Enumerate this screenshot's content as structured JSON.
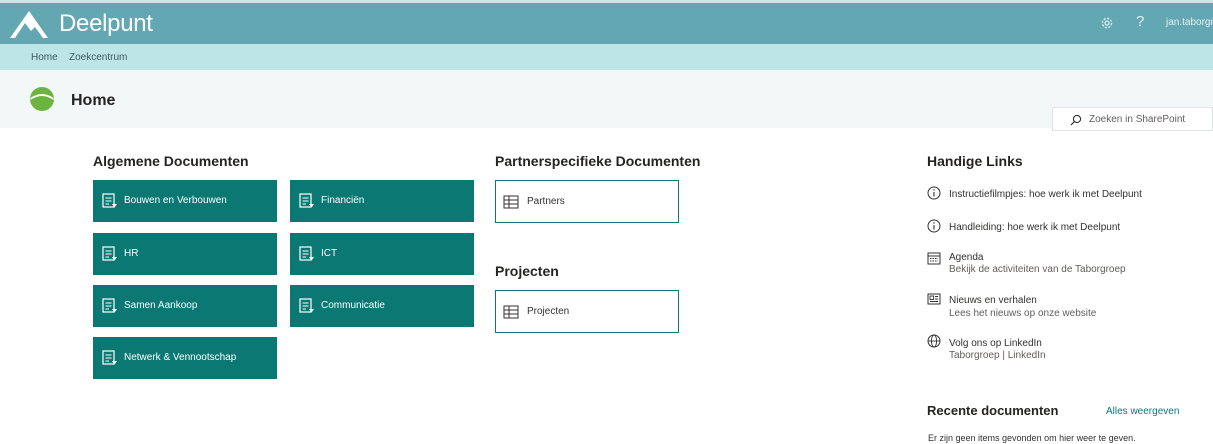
{
  "app": {
    "title": "Deelpunt",
    "user": "jan.taborgr"
  },
  "topbar": {
    "help_label": "?"
  },
  "nav": {
    "items": [
      "Home",
      "Zoekcentrum"
    ]
  },
  "page": {
    "title": "Home"
  },
  "search": {
    "placeholder": "Zoeken in SharePoint"
  },
  "algemene": {
    "title": "Algemene Documenten",
    "tiles": [
      "Bouwen en Verbouwen",
      "Financiën",
      "HR",
      "ICT",
      "Samen Aankoop",
      "Communicatie",
      "Netwerk & Vennootschap"
    ]
  },
  "partner": {
    "title": "Partnerspecifieke Documenten",
    "tile": "Partners"
  },
  "projecten": {
    "title": "Projecten",
    "tile": "Projecten"
  },
  "links": {
    "title": "Handige Links",
    "items": [
      {
        "title": "Instructiefilmpjes: hoe werk ik met Deelpunt",
        "subtitle": "",
        "icon": "info-icon"
      },
      {
        "title": "Handleiding: hoe werk ik met Deelpunt",
        "subtitle": "",
        "icon": "info-icon"
      },
      {
        "title": "Agenda",
        "subtitle": "Bekijk de activiteiten van de Taborgroep",
        "icon": "calendar-icon"
      },
      {
        "title": "Nieuws en verhalen",
        "subtitle": "Lees het nieuws op onze website",
        "icon": "news-icon"
      },
      {
        "title": "Volg ons op LinkedIn",
        "subtitle": "Taborgroep | LinkedIn",
        "icon": "globe-icon"
      }
    ]
  },
  "recent": {
    "title": "Recente documenten",
    "see_all": "Alles weergeven",
    "empty": "Er zijn geen items gevonden om hier weer te geven."
  },
  "colors": {
    "topbar": "#63a7b3",
    "breadcrumb": "#bde4e6",
    "tile": "#0b7874",
    "accent": "#0b7874"
  }
}
